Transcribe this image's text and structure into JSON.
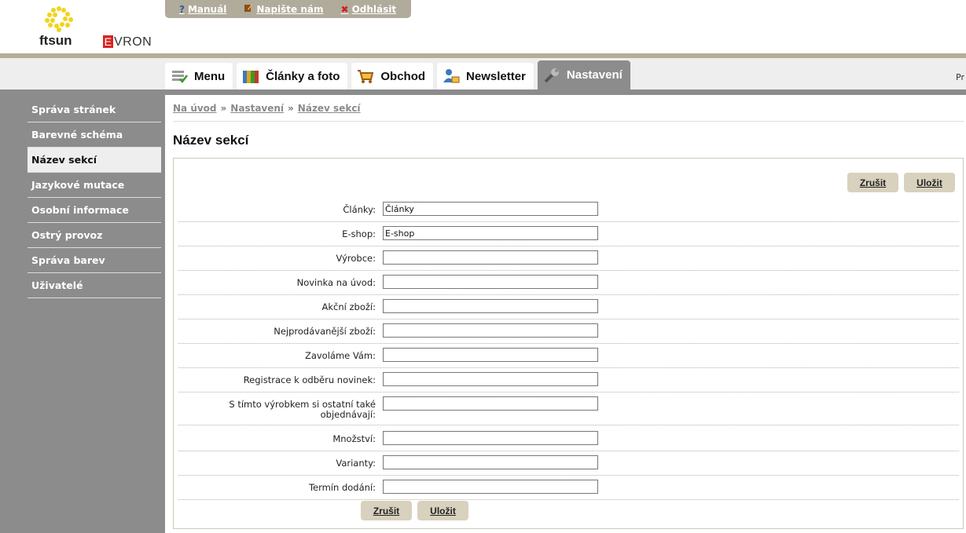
{
  "header": {
    "logo_text": "ftsun",
    "brand_text": "VRON",
    "brand_initial": "E",
    "toplinks": [
      {
        "label": "Manuál",
        "icon": "question-icon"
      },
      {
        "label": "Napište nám",
        "icon": "pencil-icon"
      },
      {
        "label": "Odhlásit",
        "icon": "close-icon"
      }
    ]
  },
  "nav": {
    "tabs": [
      {
        "label": "Menu",
        "icon": "menu-icon"
      },
      {
        "label": "Články a foto",
        "icon": "folders-icon"
      },
      {
        "label": "Obchod",
        "icon": "cart-icon"
      },
      {
        "label": "Newsletter",
        "icon": "user-mail-icon"
      },
      {
        "label": "Nastavení",
        "icon": "wrench-icon"
      }
    ],
    "right_text": "Pr"
  },
  "sidebar": {
    "items": [
      {
        "label": "Správa stránek"
      },
      {
        "label": "Barevné schéma"
      },
      {
        "label": "Název sekcí"
      },
      {
        "label": "Jazykové mutace"
      },
      {
        "label": "Osobní informace"
      },
      {
        "label": "Ostrý provoz"
      },
      {
        "label": "Správa barev"
      },
      {
        "label": "Uživatelé"
      }
    ]
  },
  "breadcrumb": {
    "items": [
      "Na úvod",
      "Nastavení",
      "Název sekcí"
    ],
    "separator": "»"
  },
  "page": {
    "title": "Název sekcí",
    "cancel_label": "Zrušit",
    "save_label": "Uložit"
  },
  "form": {
    "fields": [
      {
        "label": "Články:",
        "value": "Články"
      },
      {
        "label": "E-shop:",
        "value": "E-shop"
      },
      {
        "label": "Výrobce:",
        "value": ""
      },
      {
        "label": "Novinka na úvod:",
        "value": ""
      },
      {
        "label": "Akční zboží:",
        "value": ""
      },
      {
        "label": "Nejprodávanější zboží:",
        "value": ""
      },
      {
        "label": "Zavoláme Vám:",
        "value": ""
      },
      {
        "label": "Registrace k odběru novinek:",
        "value": ""
      },
      {
        "label": "S tímto výrobkem si ostatní také objednávají:",
        "value": ""
      },
      {
        "label": "Množství:",
        "value": ""
      },
      {
        "label": "Varianty:",
        "value": ""
      },
      {
        "label": "Termín dodání:",
        "value": ""
      }
    ]
  },
  "colors": {
    "sidebar_bg": "#8c8c8c",
    "accent_brown": "#b5ad98",
    "button_bg": "#d8d1bd",
    "brand_red": "#d8231f",
    "logo_yellow": "#f2d31b"
  }
}
